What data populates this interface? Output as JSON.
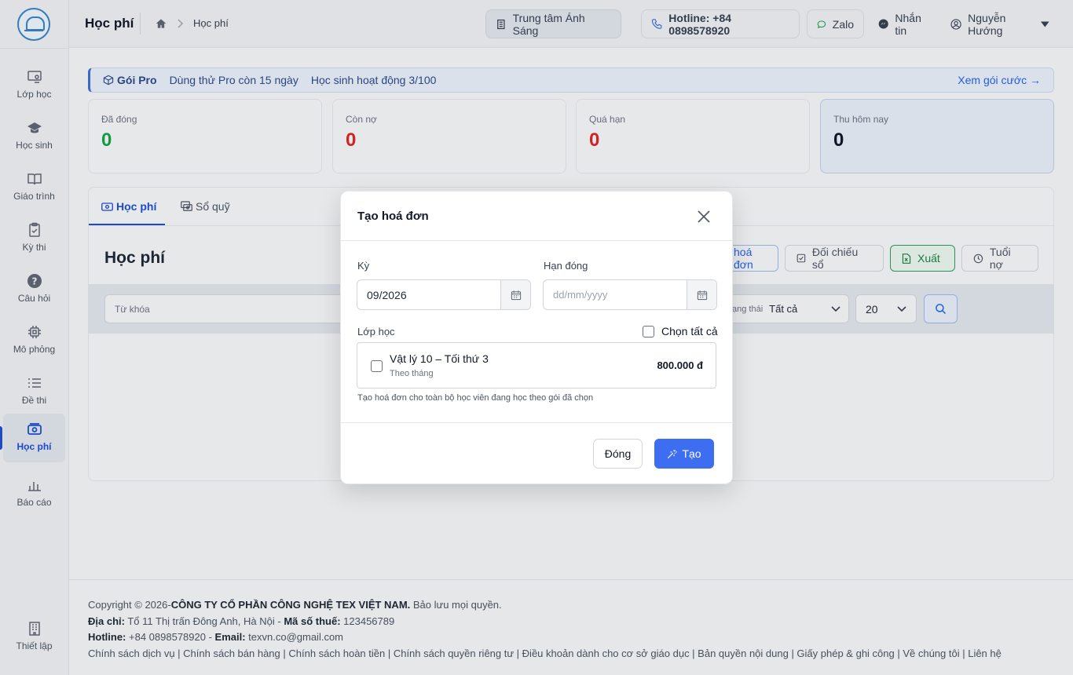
{
  "sidebar": {
    "items": [
      {
        "label": "Lớp học",
        "icon": "classroom-icon"
      },
      {
        "label": "Học sinh",
        "icon": "graduation-cap-icon"
      },
      {
        "label": "Giáo trình",
        "icon": "book-icon"
      },
      {
        "label": "Kỳ thi",
        "icon": "clipboard-icon"
      },
      {
        "label": "Câu hỏi",
        "icon": "question-icon"
      },
      {
        "label": "Mô phỏng",
        "icon": "chip-icon"
      },
      {
        "label": "Đề thi",
        "icon": "list-icon"
      },
      {
        "label": "Học phí",
        "icon": "money-icon",
        "active": true
      },
      {
        "label": "Báo cáo",
        "icon": "bar-chart-icon"
      }
    ],
    "settings_label": "Thiết lập"
  },
  "header": {
    "title": "Học phí",
    "breadcrumb": "Học phí",
    "center_name": "Trung tâm Ánh Sáng",
    "hotline": "Hotline: +84 0898578920",
    "zalo": "Zalo",
    "message": "Nhắn tin",
    "user": "Nguyễn Hướng"
  },
  "promo": {
    "plan": "Gói Pro",
    "trial": "Dùng thử Pro còn 15 ngày",
    "students": "Học sinh hoạt động 3/100",
    "link": "Xem gói cước →"
  },
  "stats": [
    {
      "label": "Đã đóng",
      "value": "0"
    },
    {
      "label": "Còn nợ",
      "value": "0"
    },
    {
      "label": "Quá hạn",
      "value": "0"
    },
    {
      "label": "Thu hôm nay",
      "value": "0"
    }
  ],
  "tabs": {
    "fees": "Học phí",
    "ledger": "Sổ quỹ"
  },
  "panel": {
    "title": "Học phí",
    "create_invoice": "hoá đơn",
    "reconcile": "Đối chiếu sổ",
    "export": "Xuất",
    "aging": "Tuổi nợ",
    "keyword_placeholder": "Từ khóa",
    "status_label": "ạng thái",
    "status_value": "Tất cả",
    "page_size": "20"
  },
  "modal": {
    "title": "Tạo hoá đơn",
    "period_label": "Kỳ",
    "period_value": "09/2026",
    "due_label": "Hạn đóng",
    "due_placeholder": "dd/mm/yyyy",
    "class_label": "Lớp học",
    "select_all": "Chọn tất cả",
    "class_name": "Vật lý 10 – Tối thứ 3",
    "class_billing": "Theo tháng",
    "class_price": "800.000 đ",
    "hint": "Tạo hoá đơn cho toàn bộ học viên đang học theo gói đã chọn",
    "close_btn": "Đóng",
    "create_btn": "Tạo"
  },
  "footer": {
    "copyright_prefix": "Copyright © 2026-",
    "company": "CÔNG TY CỔ PHẦN CÔNG NGHỆ TEX VIỆT NAM.",
    "rights": " Bảo lưu mọi quyền.",
    "address_label": "Địa chỉ:",
    "address": " Tổ 11 Thị trấn Đông Anh, Hà Nội - ",
    "tax_label": "Mã số thuế:",
    "tax": " 123456789",
    "hotline_label": "Hotline:",
    "hotline": " +84 0898578920 - ",
    "email_label": "Email:",
    "email": " texvn.co@gmail.com",
    "links": "Chính sách dịch vụ | Chính sách bán hàng | Chính sách hoàn tiền | Chính sách quyền riêng tư | Điều khoản dành cho cơ sở giáo dục | Bản quyền nội dung | Giấy phép & ghi công | Về chúng tôi | Liên hệ"
  },
  "colors": {
    "accent": "#3d6ef2",
    "success": "#16a34a",
    "danger": "#dc2626"
  }
}
